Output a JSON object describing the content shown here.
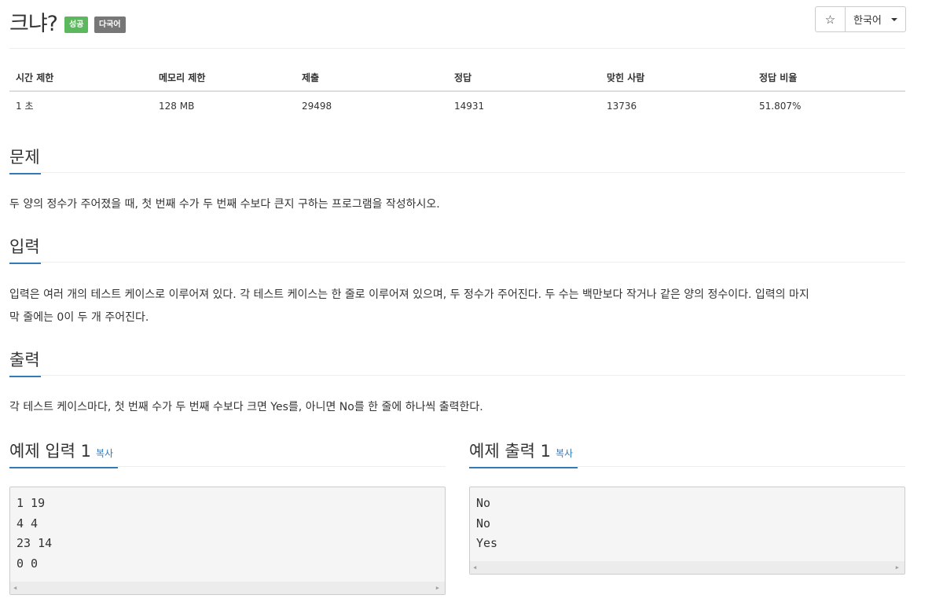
{
  "problem": {
    "title": "크냐?",
    "badges": {
      "success": "성공",
      "multilang": "다국어"
    }
  },
  "toolbar": {
    "star_icon": "☆",
    "language": "한국어"
  },
  "info": {
    "headers": [
      "시간 제한",
      "메모리 제한",
      "제출",
      "정답",
      "맞힌 사람",
      "정답 비율"
    ],
    "values": [
      "1 초",
      "128 MB",
      "29498",
      "14931",
      "13736",
      "51.807%"
    ]
  },
  "sections": {
    "problem": {
      "title": "문제",
      "text": "두 양의 정수가 주어졌을 때, 첫 번째 수가 두 번째 수보다 큰지 구하는 프로그램을 작성하시오."
    },
    "input": {
      "title": "입력",
      "line1": "입력은 여러 개의 테스트 케이스로 이루어져 있다. 각 테스트 케이스는 한 줄로 이루어져 있으며, 두 정수가 주어진다. 두 수는 백만보다 작거나 같은 양의 정수이다. 입력의 마지",
      "line2": "막 줄에는 0이 두 개 주어진다."
    },
    "output": {
      "title": "출력",
      "text": "각 테스트 케이스마다, 첫 번째 수가 두 번째 수보다 크면 Yes를, 아니면 No를 한 줄에 하나씩 출력한다."
    }
  },
  "samples": {
    "input": {
      "title": "예제 입력 1",
      "copy": "복사",
      "lines": [
        "1 19",
        "4 4",
        "23 14",
        "0 0"
      ]
    },
    "output": {
      "title": "예제 출력 1",
      "copy": "복사",
      "lines": [
        "No",
        "No",
        "Yes"
      ]
    }
  },
  "scroll": {
    "left_arrow": "◀",
    "right_arrow": "▶"
  }
}
